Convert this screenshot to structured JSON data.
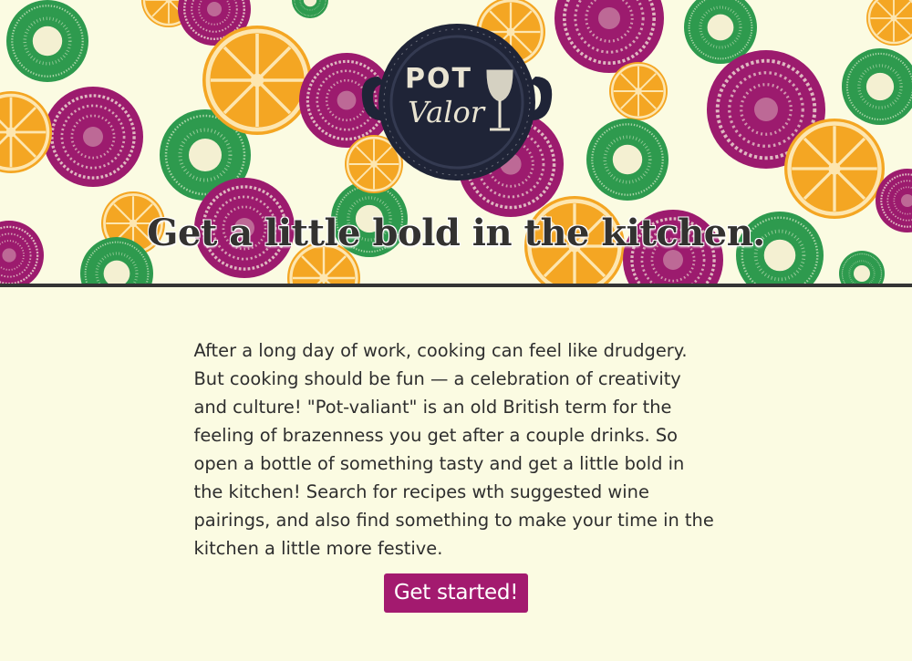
{
  "brand": {
    "logo_line1": "POT",
    "logo_line2": "Valor"
  },
  "hero": {
    "headline": "Get a little bold in the kitchen."
  },
  "intro": {
    "text": "After a long day of work, cooking can feel like drudgery. But cooking should be fun — a celebration of creativity and culture! \"Pot-valiant\" is an old British term for the feeling of brazenness you get after a couple drinks. So open a bottle of something tasty and get a little bold in the kitchen! Search for recipes wth suggested wine pairings, and also find something to make your time in the kitchen a little more festive."
  },
  "cta": {
    "label": "Get started!"
  },
  "colors": {
    "background": "#fbfbe2",
    "beet": "#9c1b6e",
    "lime": "#2e9a4e",
    "orange": "#f4a623",
    "logo_dark": "#1f2437",
    "button": "#a31a6f"
  }
}
